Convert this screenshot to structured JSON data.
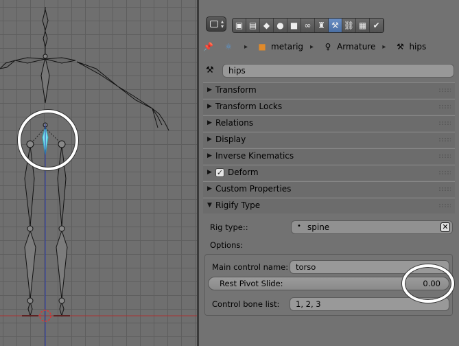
{
  "properties": {
    "editor_icon": "properties-editor-icon",
    "context_tabs": [
      {
        "name": "render-tab",
        "icon": "camera-icon",
        "glyph": "▣",
        "active": false
      },
      {
        "name": "render-layers-tab",
        "icon": "layers-icon",
        "glyph": "▤",
        "active": false
      },
      {
        "name": "scene-tab",
        "icon": "scene-icon",
        "glyph": "◆",
        "active": false
      },
      {
        "name": "world-tab",
        "icon": "world-icon",
        "glyph": "●",
        "active": false
      },
      {
        "name": "object-tab",
        "icon": "object-cube-icon",
        "glyph": "■",
        "active": false
      },
      {
        "name": "constraints-tab",
        "icon": "link-icon",
        "glyph": "∞",
        "active": false
      },
      {
        "name": "armature-tab",
        "icon": "armature-icon",
        "glyph": "♜",
        "active": false
      },
      {
        "name": "bone-tab",
        "icon": "bone-icon",
        "glyph": "⚒",
        "active": true
      },
      {
        "name": "bone-constraints-tab",
        "icon": "bone-constraint-icon",
        "glyph": "⛓",
        "active": false
      },
      {
        "name": "texture-tab",
        "icon": "texture-checker-icon",
        "glyph": "▦",
        "active": false
      },
      {
        "name": "physics-tab",
        "icon": "physics-icon",
        "glyph": "✔",
        "active": false
      }
    ],
    "breadcrumb": {
      "pin_icon": "pin-icon",
      "scene_icon": "scene-icon",
      "object_label": "metarig",
      "object_icon": "object-cube-icon",
      "data_label": "Armature",
      "data_icon": "armature-icon",
      "bone_label": "hips",
      "bone_icon": "bone-icon"
    },
    "bone_name": {
      "icon": "bone-icon",
      "value": "hips"
    },
    "panels": [
      {
        "label": "Transform",
        "expanded": false
      },
      {
        "label": "Transform Locks",
        "expanded": false
      },
      {
        "label": "Relations",
        "expanded": false
      },
      {
        "label": "Display",
        "expanded": false
      },
      {
        "label": "Inverse Kinematics",
        "expanded": false
      },
      {
        "label": "Deform",
        "expanded": false,
        "checkbox": true
      },
      {
        "label": "Custom Properties",
        "expanded": false
      },
      {
        "label": "Rigify Type",
        "expanded": true
      }
    ],
    "rigify": {
      "rig_type_label": "Rig type::",
      "rig_type_value": "spine",
      "options_label": "Options:",
      "main_control_label": "Main control name:",
      "main_control_value": "torso",
      "rest_pivot_label": "Rest Pivot Slide:",
      "rest_pivot_value": "0.00",
      "control_bone_label": "Control bone list:",
      "control_bone_value": "1, 2, 3"
    }
  },
  "colors": {
    "viewport_bg": "#6f6f6f",
    "selected_bone": "#7fe3f0",
    "active_tab": "#5b80b8",
    "annotation": "#ffffff"
  }
}
